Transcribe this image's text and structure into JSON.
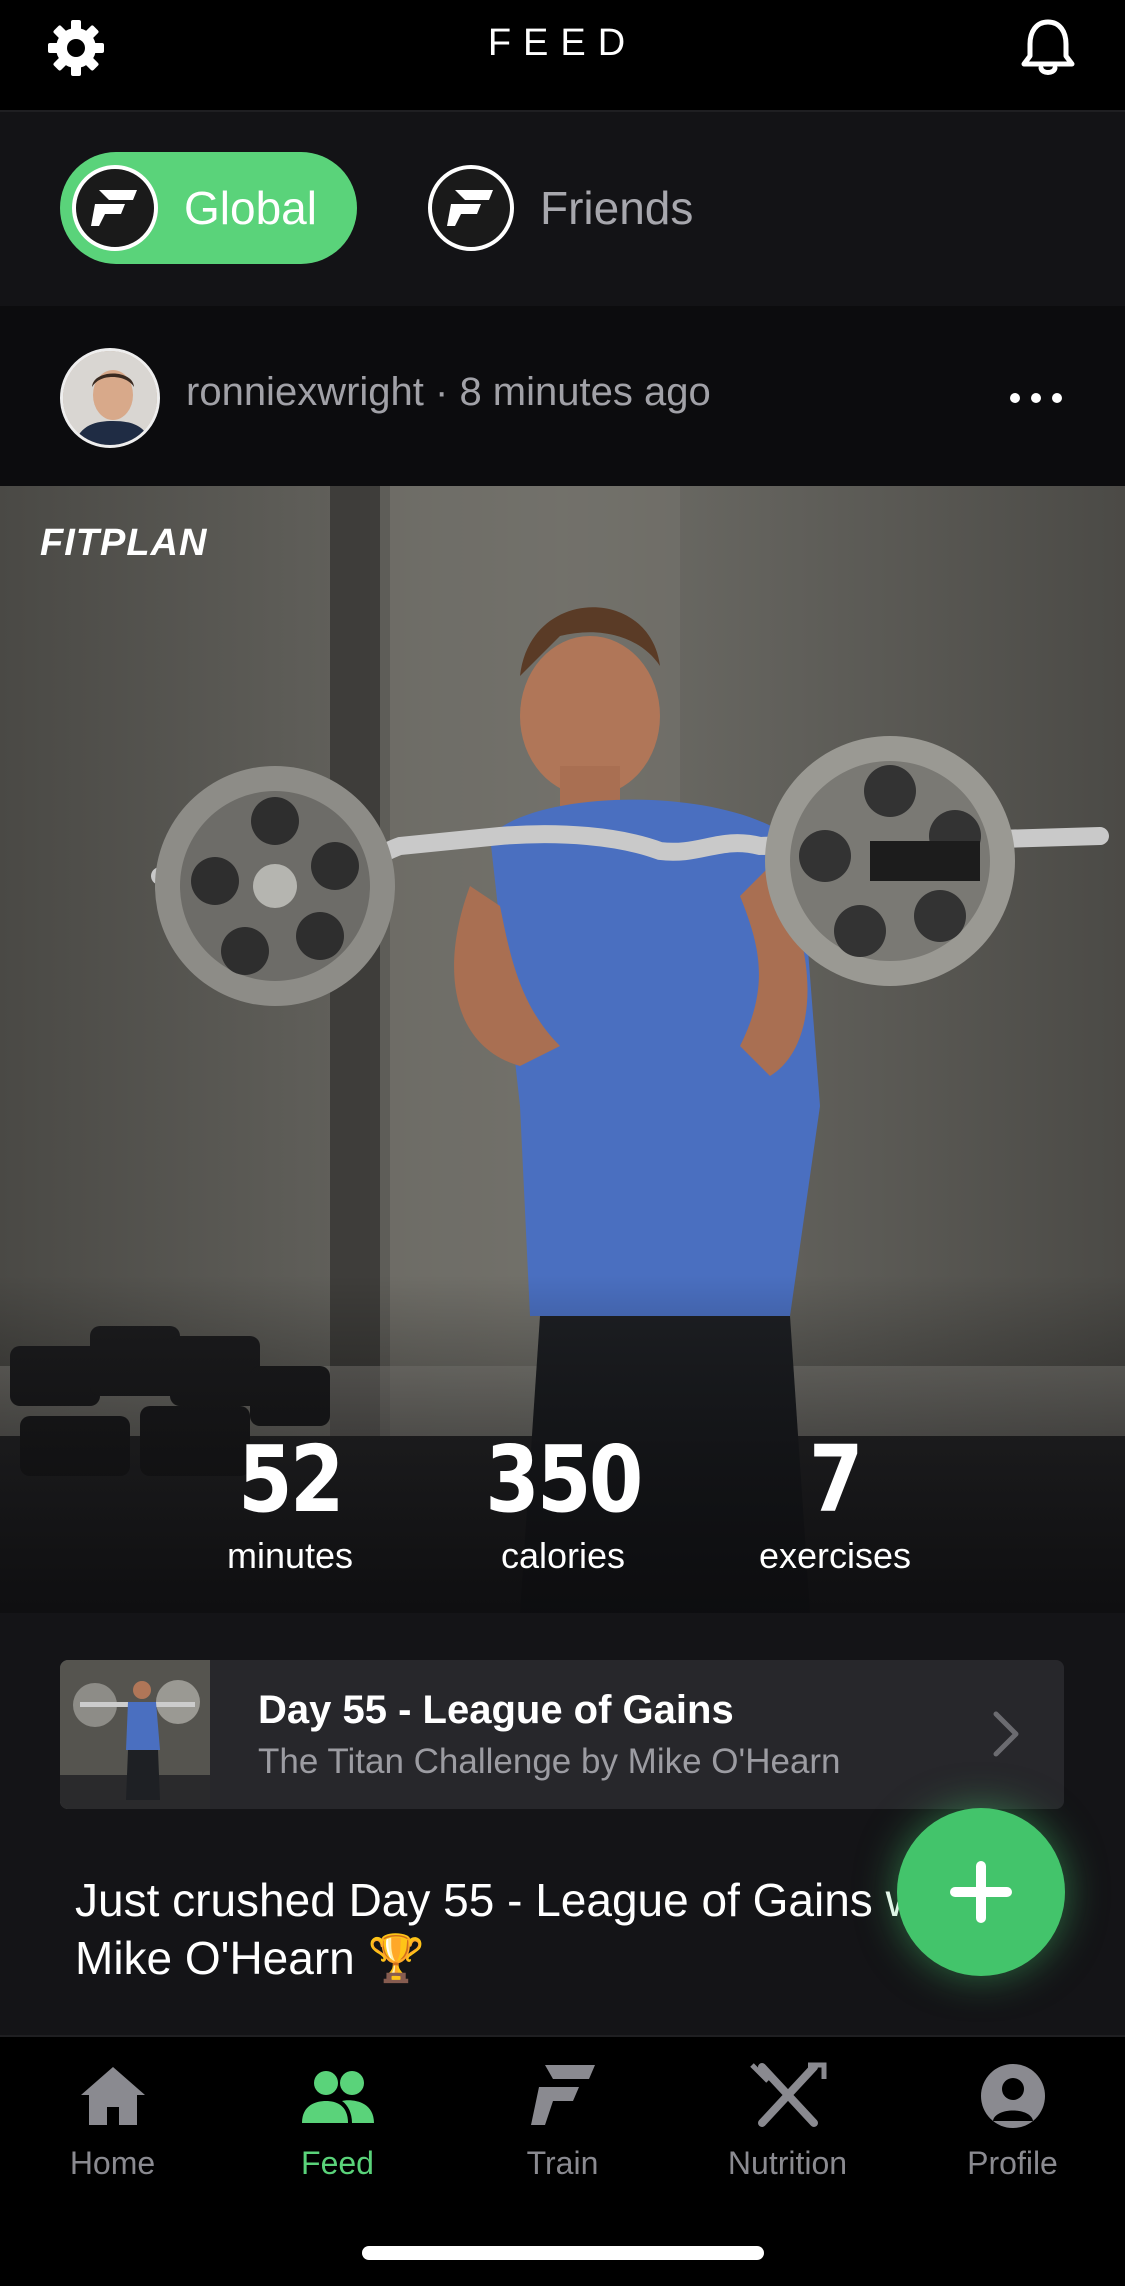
{
  "header": {
    "title": "FEED",
    "settings_icon": "gear-icon",
    "notifications_icon": "bell-icon"
  },
  "filters": {
    "active_color": "#5ad37a",
    "items": [
      {
        "label": "Global",
        "icon": "fitplan-logo-icon",
        "selected": true
      },
      {
        "label": "Friends",
        "icon": "fitplan-logo-icon",
        "selected": false
      }
    ]
  },
  "post": {
    "meta": "ronniexwright · 8 minutes ago",
    "brand": "FITPLAN",
    "stats": [
      {
        "value": "52",
        "label": "minutes"
      },
      {
        "value": "350",
        "label": "calories"
      },
      {
        "value": "7",
        "label": "exercises"
      }
    ],
    "plan": {
      "title": "Day 55 - League of Gains",
      "subtitle": "The Titan Challenge by Mike O'Hearn"
    },
    "caption_line1": "Just crushed Day 55 - League of Gains w",
    "caption_line2": "Mike O'Hearn 🏆"
  },
  "fab": {
    "icon": "plus-icon"
  },
  "nav": {
    "active_color": "#5ad37a",
    "items": [
      {
        "label": "Home",
        "icon": "home-icon"
      },
      {
        "label": "Feed",
        "icon": "people-icon",
        "active": true
      },
      {
        "label": "Train",
        "icon": "fitplan-f-icon"
      },
      {
        "label": "Nutrition",
        "icon": "fork-knife-icon"
      },
      {
        "label": "Profile",
        "icon": "person-icon"
      }
    ]
  }
}
